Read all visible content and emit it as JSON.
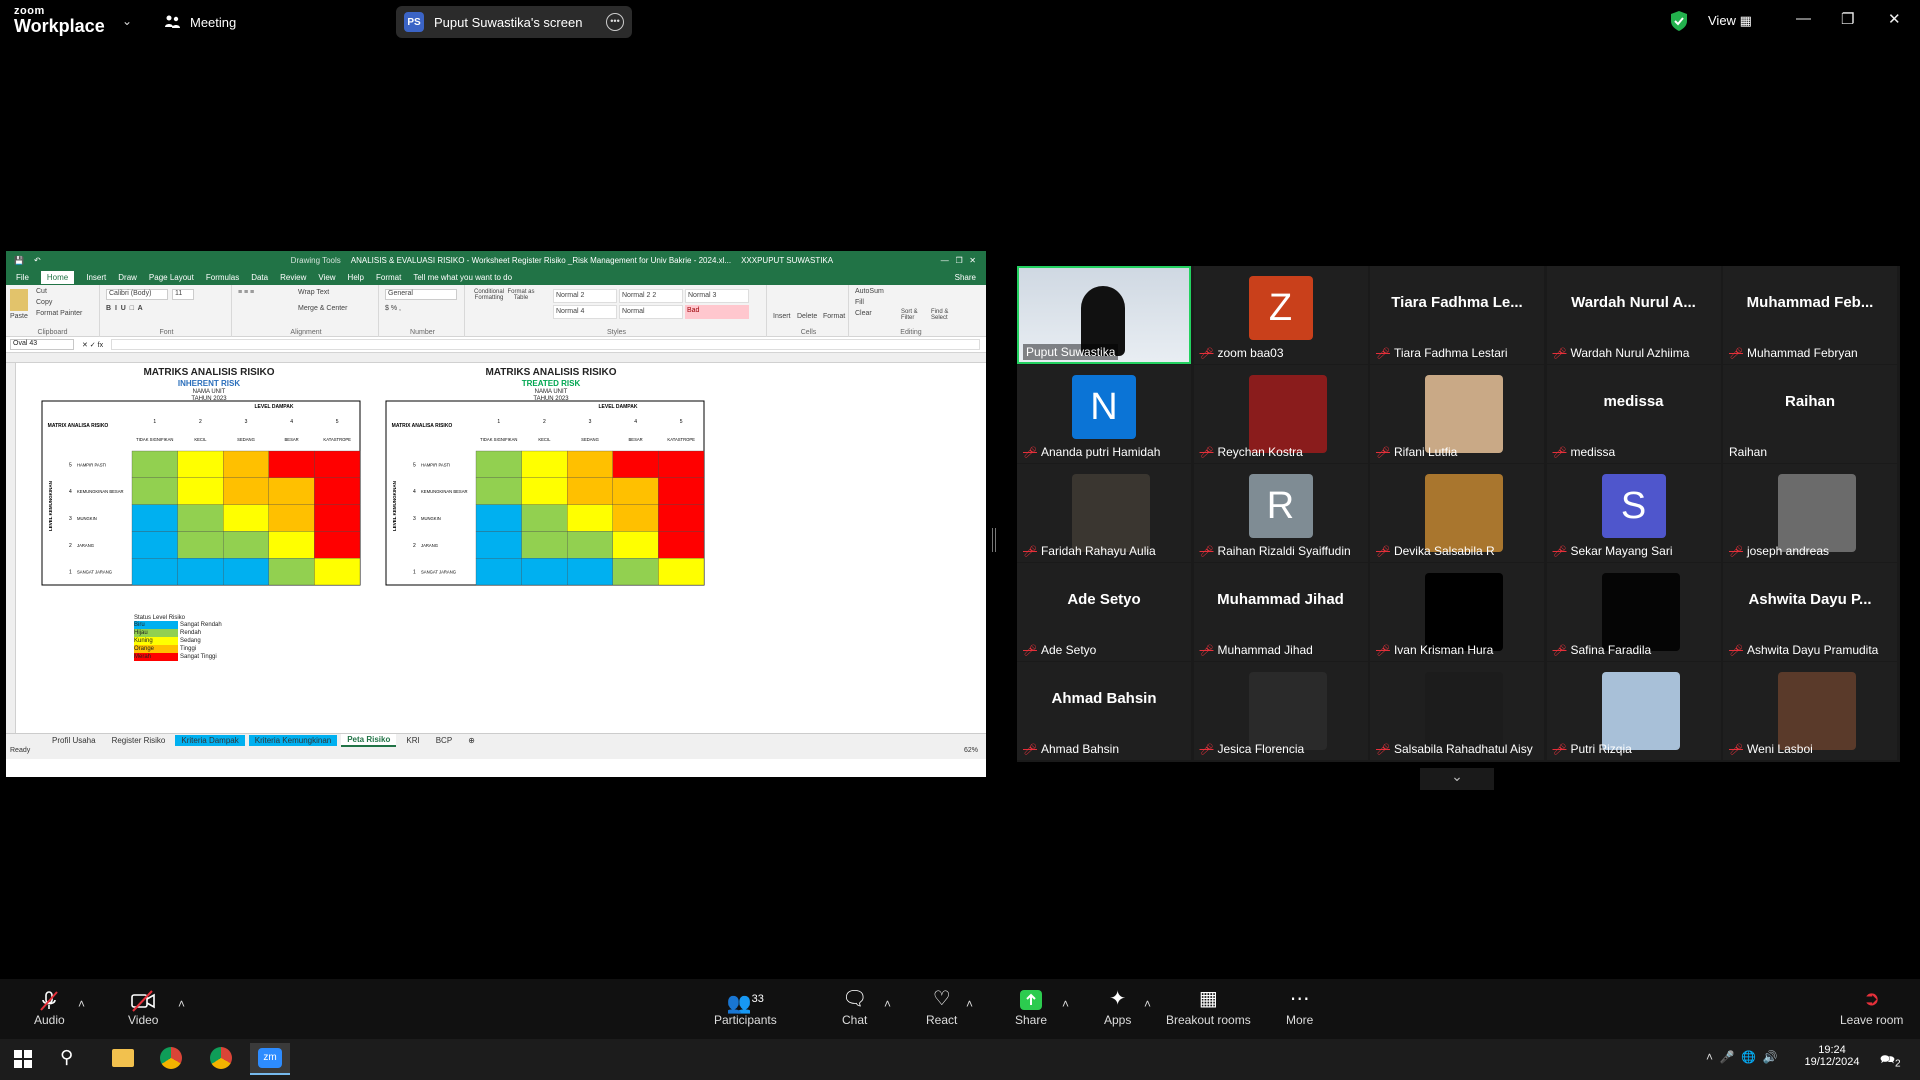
{
  "app": {
    "brand_line1": "zoom",
    "brand_line2": "Workplace",
    "meeting_label": "Meeting",
    "screen_share_initials": "PS",
    "screen_share_title": "Puput Suwastika's screen",
    "view_label": "View"
  },
  "excel": {
    "window_title": "ANALISIS & EVALUASI RISIKO - Worksheet Register Risiko _Risk Management for Univ Bakrie - 2024.xl...",
    "user": "XXXPUPUT SUWASTIKA",
    "drawing_tools": "Drawing Tools",
    "tabs": [
      "File",
      "Home",
      "Insert",
      "Draw",
      "Page Layout",
      "Formulas",
      "Data",
      "Review",
      "View",
      "Help",
      "Format"
    ],
    "tell_me": "Tell me what you want to do",
    "share": "Share",
    "ribbon": {
      "paste": "Paste",
      "cut": "Cut",
      "copy": "Copy",
      "format_painter": "Format Painter",
      "clipboard": "Clipboard",
      "font_name": "Calibri (Body)",
      "font_size": "11",
      "font": "Font",
      "wrap_text": "Wrap Text",
      "merge": "Merge & Center",
      "alignment": "Alignment",
      "number_format": "General",
      "number": "Number",
      "cond_format": "Conditional Formatting",
      "format_as_table": "Format as Table",
      "styles": [
        "Normal 2",
        "Normal 2 2",
        "Normal 3",
        "Normal 4",
        "Normal",
        "Bad"
      ],
      "styles_label": "Styles",
      "insert": "Insert",
      "delete": "Delete",
      "format": "Format",
      "cells": "Cells",
      "autosum": "AutoSum",
      "fill": "Fill",
      "clear": "Clear",
      "sort_filter": "Sort & Filter",
      "find_select": "Find & Select",
      "editing": "Editing"
    },
    "name_box": "Oval 43",
    "matrix_left": {
      "title": "MATRIKS ANALISIS RISIKO",
      "subtitle": "INHERENT RISK",
      "unit": "NAMA UNIT",
      "year": "TAHUN 2023"
    },
    "matrix_right": {
      "title": "MATRIKS ANALISIS RISIKO",
      "subtitle": "TREATED RISK",
      "unit": "NAMA UNIT",
      "year": "TAHUN 2023"
    },
    "matrix_header": "MATRIX ANALISA RISIKO",
    "level_dampak": "LEVEL DAMPAK",
    "level_kemungkinan": "LEVEL KEMUNGKINAN",
    "impact_cols": [
      {
        "n": "1",
        "label": "TIDAK SIGNIFIKAN"
      },
      {
        "n": "2",
        "label": "KECIL"
      },
      {
        "n": "3",
        "label": "SEDANG"
      },
      {
        "n": "4",
        "label": "BESAR"
      },
      {
        "n": "5",
        "label": "KATASTROPE"
      }
    ],
    "likelihood_rows": [
      {
        "n": "5",
        "label": "HAMPIR PASTI"
      },
      {
        "n": "4",
        "label": "KEMUNGKINAN BESAR"
      },
      {
        "n": "3",
        "label": "MUNGKIN"
      },
      {
        "n": "2",
        "label": "JARANG"
      },
      {
        "n": "1",
        "label": "SANGAT JARANG"
      }
    ],
    "legend_title": "Status Level Risiko",
    "legend": [
      {
        "c": "Biru",
        "v": "Sangat Rendah"
      },
      {
        "c": "Hijau",
        "v": "Rendah"
      },
      {
        "c": "Kuning",
        "v": "Sedang"
      },
      {
        "c": "Orange",
        "v": "Tinggi"
      },
      {
        "c": "Merah",
        "v": "Sangat Tinggi"
      }
    ],
    "sheet_tabs": [
      "Profil Usaha",
      "Register Risiko",
      "Kriteria Dampak",
      "Kriteria Kemungkinan",
      "Peta Risiko",
      "KRI",
      "BCP"
    ],
    "status": "Ready",
    "zoom": "62%"
  },
  "participants": [
    {
      "name": "Puput Suwastika",
      "display": "",
      "kind": "video",
      "muted": false
    },
    {
      "name": "zoom baa03",
      "display": "Z",
      "kind": "avatar",
      "color": "#c9401b",
      "muted": true
    },
    {
      "name": "Tiara Fadhma Lestari",
      "display": "Tiara Fadhma Le...",
      "kind": "text",
      "muted": true
    },
    {
      "name": "Wardah Nurul Azhiima",
      "display": "Wardah Nurul A...",
      "kind": "text",
      "muted": true
    },
    {
      "name": "Muhammad Febryan",
      "display": "Muhammad Feb...",
      "kind": "text",
      "muted": true
    },
    {
      "name": "Ananda putri Hamidah",
      "display": "N",
      "kind": "avatar",
      "color": "#0b74d6",
      "muted": true
    },
    {
      "name": "Reychan Kostra",
      "display": "",
      "kind": "photo",
      "color": "#8a1c1c",
      "muted": true
    },
    {
      "name": "Rifani Lutfia",
      "display": "",
      "kind": "photo",
      "color": "#c9a986",
      "muted": true
    },
    {
      "name": "medissa",
      "display": "medissa",
      "kind": "text",
      "muted": true
    },
    {
      "name": "Raihan",
      "display": "Raihan",
      "kind": "text",
      "muted": false
    },
    {
      "name": "Faridah Rahayu Aulia",
      "display": "",
      "kind": "photo",
      "color": "#3a3630",
      "muted": true
    },
    {
      "name": "Raihan Rizaldi Syaiffudin",
      "display": "R",
      "kind": "avatar",
      "color": "#7f8c94",
      "muted": true
    },
    {
      "name": "Devika Salsabila R",
      "display": "",
      "kind": "photo",
      "color": "#a9762e",
      "muted": true
    },
    {
      "name": "Sekar Mayang Sari",
      "display": "S",
      "kind": "avatar",
      "color": "#4f56cc",
      "muted": true
    },
    {
      "name": "joseph andreas",
      "display": "",
      "kind": "photo",
      "color": "#6b6b6b",
      "muted": true
    },
    {
      "name": "Ade Setyo",
      "display": "Ade Setyo",
      "kind": "text",
      "muted": true
    },
    {
      "name": "Muhammad Jihad",
      "display": "Muhammad Jihad",
      "kind": "text",
      "muted": true
    },
    {
      "name": "Ivan Krisman Hura",
      "display": "",
      "kind": "photo",
      "color": "#000000",
      "muted": true
    },
    {
      "name": "Safina Faradila",
      "display": "",
      "kind": "photo",
      "color": "#050505",
      "muted": true
    },
    {
      "name": "Ashwita Dayu Pramudita",
      "display": "Ashwita Dayu P...",
      "kind": "text",
      "muted": true
    },
    {
      "name": "Ahmad Bahsin",
      "display": "Ahmad Bahsin",
      "kind": "text",
      "muted": true
    },
    {
      "name": "Jesica Florencia",
      "display": "",
      "kind": "photo",
      "color": "#2a2a2a",
      "muted": true
    },
    {
      "name": "Salsabila Rahadhatul Aisy",
      "display": "",
      "kind": "photo",
      "color": "#1c1c1c",
      "muted": true
    },
    {
      "name": "Putri Rizqia",
      "display": "",
      "kind": "photo",
      "color": "#a8c0d8",
      "muted": true
    },
    {
      "name": "Weni Lasboi",
      "display": "",
      "kind": "photo",
      "color": "#5a3a2a",
      "muted": true
    }
  ],
  "toolbar": {
    "audio": "Audio",
    "video": "Video",
    "participants": "Participants",
    "participants_count": "33",
    "chat": "Chat",
    "react": "React",
    "share": "Share",
    "apps": "Apps",
    "breakout": "Breakout rooms",
    "more": "More",
    "leave": "Leave room"
  },
  "taskbar": {
    "time": "19:24",
    "date": "19/12/2024",
    "notif": "2"
  },
  "colors": {
    "blue": "#00b0f0",
    "green": "#92d050",
    "yellow": "#ffff00",
    "orange": "#ffc000",
    "red": "#ff0000",
    "excel_green": "#217346"
  }
}
